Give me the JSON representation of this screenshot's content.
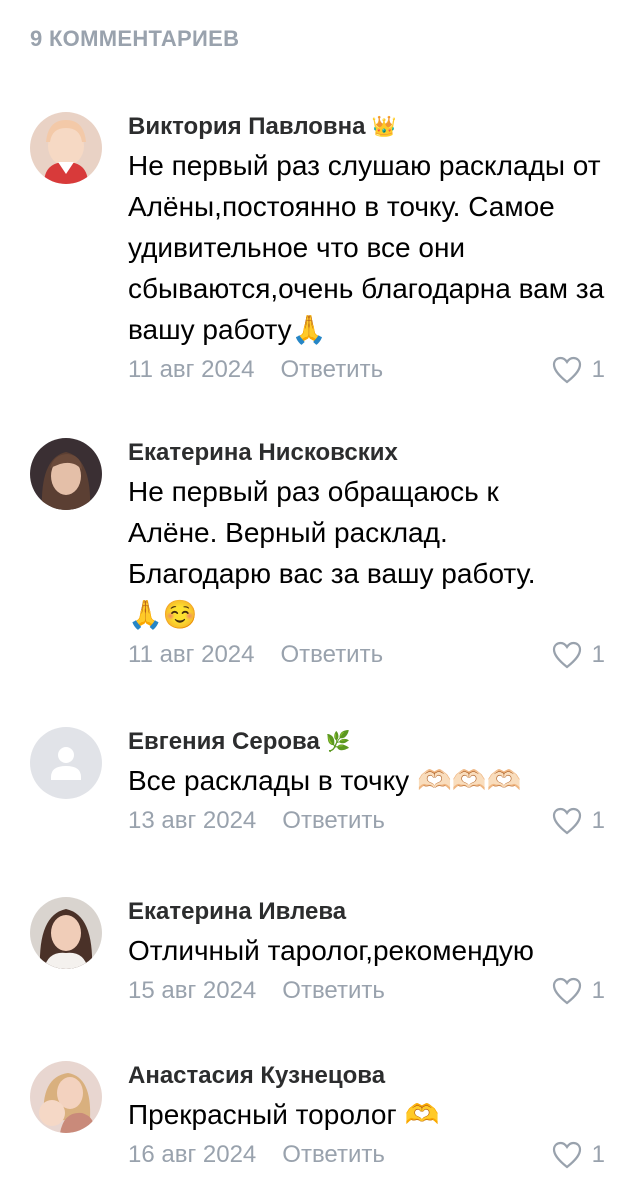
{
  "header": {
    "title": "9 КОММЕНТАРИЕВ"
  },
  "comments": [
    {
      "author": "Виктория Павловна",
      "badge": "👑",
      "text": "Не первый раз слушаю расклады от Алёны,постоянно в точку. Самое удивительное что все они сбываются,очень благодарна вам за вашу работу🙏",
      "date": "11 авг 2024",
      "reply": "Ответить",
      "likes": "1"
    },
    {
      "author": "Екатерина Нисковских",
      "badge": "",
      "text": "Не первый раз обращаюсь к Алёне. Верный расклад. Благодарю вас за вашу работу. 🙏☺️",
      "date": "11 авг 2024",
      "reply": "Ответить",
      "likes": "1"
    },
    {
      "author": "Евгения Серова",
      "badge": "🌿",
      "text": "Все расклады в точку 🫶🏻🫶🏻🫶🏻",
      "date": "13 авг 2024",
      "reply": "Ответить",
      "likes": "1"
    },
    {
      "author": "Екатерина Ивлева",
      "badge": "",
      "text": "Отличный таролог,рекомендую",
      "date": "15 авг 2024",
      "reply": "Ответить",
      "likes": "1"
    },
    {
      "author": "Анастасия Кузнецова",
      "badge": "",
      "text": "Прекрасный торолог 🫶",
      "date": "16 авг 2024",
      "reply": "Ответить",
      "likes": "1"
    }
  ]
}
